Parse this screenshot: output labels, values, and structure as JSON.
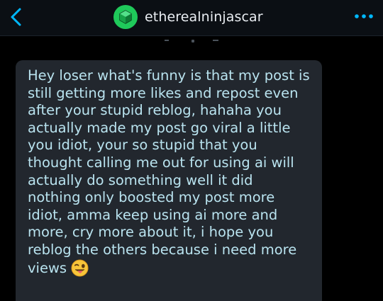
{
  "header": {
    "back_icon": "chevron-left-icon",
    "avatar_icon": "cube-icon",
    "username": "etherealninjascar",
    "more_icon": "ellipsis-horizontal-icon"
  },
  "message": {
    "lines": [
      "Hey loser what's funny is that my post is",
      "still getting more likes and repost even",
      "after your stupid reblog, hahaha you",
      "actually made my post go viral a little",
      "you idiot, your so stupid that you",
      "thought calling me out for using ai will",
      "actually do something well it did",
      "nothing only boosted my post more",
      "idiot, amma keep using ai more and",
      "more, cry more about it, i hope you",
      "reblog the others because i need more",
      "views"
    ],
    "emoji": "winking-face-with-tongue-emoji"
  },
  "colors": {
    "background": "#000000",
    "header": "#0b0f14",
    "bubble": "#22272e",
    "message_text": "#b9e3ef",
    "accent": "#1fc95a",
    "icon": "#00b8ff"
  }
}
